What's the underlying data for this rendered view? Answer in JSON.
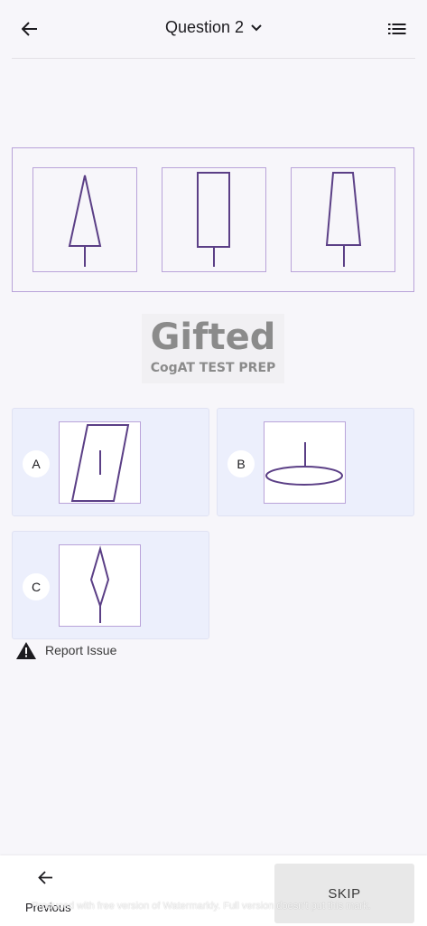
{
  "header": {
    "title": "Question 2",
    "back_icon": "arrow-left-icon",
    "dropdown_icon": "chevron-down-icon",
    "list_icon": "question-list-icon"
  },
  "question": {
    "figures": [
      "triangle-on-stem",
      "rectangle-on-stem",
      "trapezoid-on-stem"
    ]
  },
  "logo": {
    "main": "Gifted",
    "sub": "CogAT TEST PREP"
  },
  "options": [
    {
      "letter": "A",
      "figure": "parallelogram-with-line"
    },
    {
      "letter": "B",
      "figure": "ellipse-with-stem"
    },
    {
      "letter": "C",
      "figure": "diamond-on-stem"
    }
  ],
  "report": {
    "label": "Report Issue",
    "icon": "warning-icon"
  },
  "footer": {
    "previous_label": "Previous",
    "skip_label": "SKIP"
  },
  "watermark": "Produced with free version of Watermarkly. Full version doesn't put this mark.",
  "colors": {
    "accent": "#b9a3d9",
    "stroke": "#5b3f86",
    "option_bg": "#eceffc",
    "page_bg": "#f7f6fa"
  }
}
